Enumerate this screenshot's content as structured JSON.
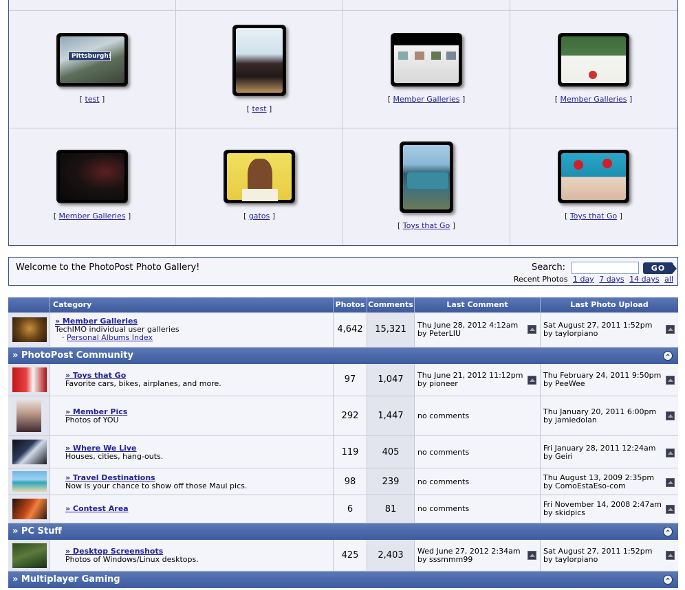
{
  "gallery": {
    "items": [
      {
        "label": "test"
      },
      {
        "label": "test"
      },
      {
        "label": "Member Galleries"
      },
      {
        "label": "Member Galleries"
      },
      {
        "label": "Member Galleries"
      },
      {
        "label": "gatos"
      },
      {
        "label": "Toys that Go"
      },
      {
        "label": "Toys that Go"
      }
    ],
    "thumb_text": "Pittsburgh!"
  },
  "welcome": {
    "message": "Welcome to the PhotoPost Photo Gallery!",
    "search_label": "Search:",
    "search_value": "",
    "go_label": "GO",
    "recent_label": "Recent Photos",
    "recent_links": [
      "1 day",
      "7 days",
      "14 days",
      "all"
    ]
  },
  "table": {
    "headers": {
      "category": "Category",
      "photos": "Photos",
      "comments": "Comments",
      "last_comment": "Last Comment",
      "last_upload": "Last Photo Upload"
    },
    "member_galleries": {
      "title": "» Member Galleries",
      "desc": "TechIMO individual user galleries",
      "sub": "Personal Albums Index",
      "photos": "4,642",
      "comments": "15,321",
      "last_comment_date": "Thu June 28, 2012 4:12am",
      "last_comment_by": "by PeterLIU",
      "last_upload_date": "Sat August 27, 2011 1:52pm",
      "last_upload_by": "by taylorpiano"
    },
    "sections": [
      {
        "title": "» PhotoPost Community"
      },
      {
        "title": "» PC Stuff"
      },
      {
        "title": "» Multiplayer Gaming"
      }
    ],
    "rows": [
      {
        "title": "» Toys that Go",
        "desc": "Favorite cars, bikes, airplanes, and more.",
        "photos": "97",
        "comments": "1,047",
        "lc_date": "Thu June 21, 2012 11:12pm",
        "lc_by": "by pioneer",
        "lu_date": "Thu February 24, 2011 9:50pm",
        "lu_by": "by PeeWee"
      },
      {
        "title": "» Member Pics",
        "desc": "Photos of YOU",
        "photos": "292",
        "comments": "1,447",
        "lc_date": "no comments",
        "lc_by": "",
        "lu_date": "Thu January 20, 2011 6:00pm",
        "lu_by": "by jamiedolan"
      },
      {
        "title": "» Where We Live",
        "desc": "Houses, cities, hang-outs.",
        "photos": "119",
        "comments": "405",
        "lc_date": "no comments",
        "lc_by": "",
        "lu_date": "Fri January 28, 2011 12:24am",
        "lu_by": "by Geiri"
      },
      {
        "title": "» Travel Destinations",
        "desc": "Now is your chance to show off those Maui pics.",
        "photos": "98",
        "comments": "239",
        "lc_date": "no comments",
        "lc_by": "",
        "lu_date": "Thu August 13, 2009 2:35pm",
        "lu_by": "by ComoEstaEso-com"
      },
      {
        "title": "» Contest Area",
        "desc": "",
        "photos": "6",
        "comments": "81",
        "lc_date": "no comments",
        "lc_by": "",
        "lu_date": "Fri November 14, 2008 2:47am",
        "lu_by": "by skidpics"
      },
      {
        "title": "» Desktop Screenshots",
        "desc": "Photos of Windows/Linux desktops.",
        "photos": "425",
        "comments": "2,403",
        "lc_date": "Wed June 27, 2012 2:34am",
        "lc_by": "by sssmmm99",
        "lu_date": "Sat August 27, 2011 1:52pm",
        "lu_by": "by taylorpiano"
      }
    ]
  }
}
